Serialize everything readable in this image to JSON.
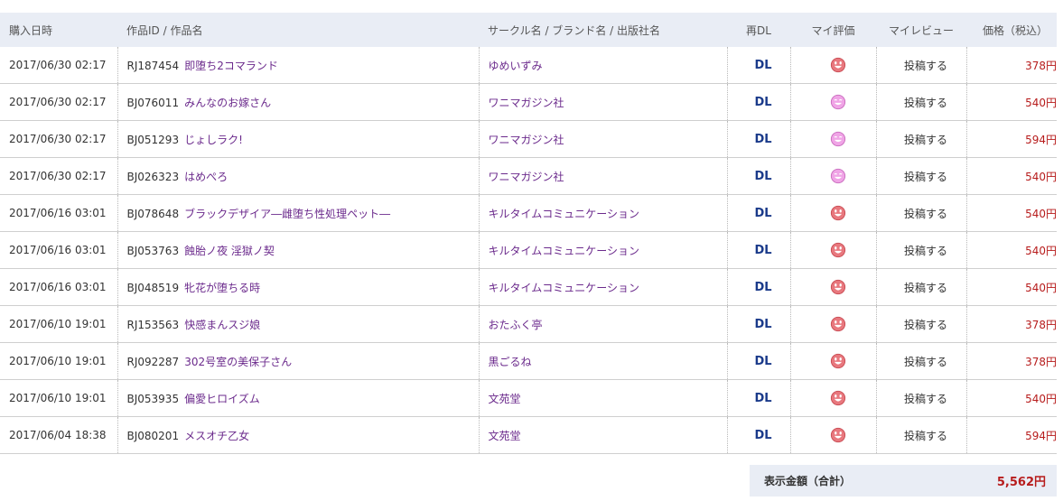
{
  "headers": {
    "date": "購入日時",
    "work": "作品ID / 作品名",
    "circle": "サークル名 / ブランド名 / 出版社名",
    "redl": "再DL",
    "rating": "マイ評価",
    "review": "マイレビュー",
    "price": "価格（税込）"
  },
  "rows": [
    {
      "date": "2017/06/30 02:17",
      "id": "RJ187454",
      "title": "即堕ち2コマランド",
      "circle": "ゆめいずみ",
      "dl": "DL",
      "face": "red",
      "review": "投稿する",
      "price": "378円"
    },
    {
      "date": "2017/06/30 02:17",
      "id": "BJ076011",
      "title": "みんなのお嫁さん",
      "circle": "ワニマガジン社",
      "dl": "DL",
      "face": "pink",
      "review": "投稿する",
      "price": "540円"
    },
    {
      "date": "2017/06/30 02:17",
      "id": "BJ051293",
      "title": "じょしラク!",
      "circle": "ワニマガジン社",
      "dl": "DL",
      "face": "pink",
      "review": "投稿する",
      "price": "594円"
    },
    {
      "date": "2017/06/30 02:17",
      "id": "BJ026323",
      "title": "はめぺろ",
      "circle": "ワニマガジン社",
      "dl": "DL",
      "face": "pink",
      "review": "投稿する",
      "price": "540円"
    },
    {
      "date": "2017/06/16 03:01",
      "id": "BJ078648",
      "title": "ブラックデザイア―雌堕ち性処理ペット―",
      "circle": "キルタイムコミュニケーション",
      "dl": "DL",
      "face": "red",
      "review": "投稿する",
      "price": "540円"
    },
    {
      "date": "2017/06/16 03:01",
      "id": "BJ053763",
      "title": "蝕胎ノ夜 淫獄ノ契",
      "circle": "キルタイムコミュニケーション",
      "dl": "DL",
      "face": "red",
      "review": "投稿する",
      "price": "540円"
    },
    {
      "date": "2017/06/16 03:01",
      "id": "BJ048519",
      "title": "牝花が堕ちる時",
      "circle": "キルタイムコミュニケーション",
      "dl": "DL",
      "face": "red",
      "review": "投稿する",
      "price": "540円"
    },
    {
      "date": "2017/06/10 19:01",
      "id": "RJ153563",
      "title": "快感まんスジ娘",
      "circle": "おたふく亭",
      "dl": "DL",
      "face": "red",
      "review": "投稿する",
      "price": "378円"
    },
    {
      "date": "2017/06/10 19:01",
      "id": "RJ092287",
      "title": "302号室の美保子さん",
      "circle": "黒ごるね",
      "dl": "DL",
      "face": "red",
      "review": "投稿する",
      "price": "378円"
    },
    {
      "date": "2017/06/10 19:01",
      "id": "BJ053935",
      "title": "偏愛ヒロイズム",
      "circle": "文苑堂",
      "dl": "DL",
      "face": "red",
      "review": "投稿する",
      "price": "540円"
    },
    {
      "date": "2017/06/04 18:38",
      "id": "BJ080201",
      "title": "メスオチ乙女",
      "circle": "文苑堂",
      "dl": "DL",
      "face": "red",
      "review": "投稿する",
      "price": "594円"
    }
  ],
  "total": {
    "label": "表示金額（合計）",
    "value": "5,562円"
  },
  "colors": {
    "face_red": "#e8787e",
    "face_pink": "#f0a4e6",
    "price": "#b71c1c",
    "link": "#6b2a8c",
    "dl": "#1a3a8a",
    "header_bg": "#e9edf5"
  }
}
